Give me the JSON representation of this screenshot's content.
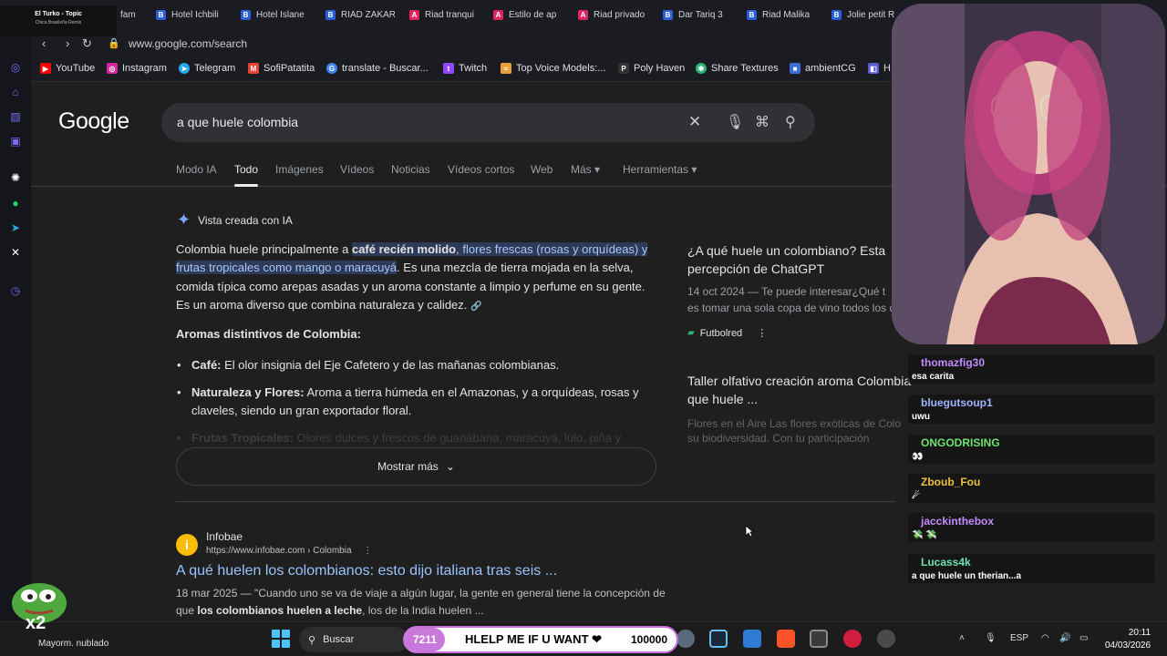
{
  "music": {
    "title": "El Turko - Topic",
    "subtitle": "Chica Brasileña Remix"
  },
  "tabs": [
    {
      "label": "fam",
      "icon": "blank"
    },
    {
      "label": "Hotel Ichbili",
      "icon": "booking"
    },
    {
      "label": "Hotel Islane",
      "icon": "booking"
    },
    {
      "label": "RIAD ZAKAR",
      "icon": "booking"
    },
    {
      "label": "Riad tranqui",
      "icon": "airbnb"
    },
    {
      "label": "Estilo de ap",
      "icon": "airbnb"
    },
    {
      "label": "Riad privado",
      "icon": "airbnb"
    },
    {
      "label": "Dar Tariq 3",
      "icon": "booking"
    },
    {
      "label": "Riad Malika",
      "icon": "booking"
    },
    {
      "label": "Jolie petit R",
      "icon": "booking"
    }
  ],
  "address": {
    "url": "www.google.com/search"
  },
  "bookmarks": [
    {
      "label": "YouTube",
      "icon": "youtube-icon",
      "color": "#ff0000"
    },
    {
      "label": "Instagram",
      "icon": "instagram-icon",
      "color": "#d6249f"
    },
    {
      "label": "Telegram",
      "icon": "telegram-icon",
      "color": "#29a9eb"
    },
    {
      "label": "SofiPatatita",
      "icon": "gmail-icon",
      "color": "#ea4335"
    },
    {
      "label": "translate - Buscar...",
      "icon": "google-icon",
      "color": "#4285f4"
    },
    {
      "label": "Twitch",
      "icon": "twitch-icon",
      "color": "#9146ff"
    },
    {
      "label": "Top Voice Models:...",
      "icon": "voice-icon",
      "color": "#e9a23b"
    },
    {
      "label": "Poly Haven",
      "icon": "polyhaven-icon",
      "color": "#dddddd"
    },
    {
      "label": "Share Textures",
      "icon": "sharetextures-icon",
      "color": "#2bb673"
    },
    {
      "label": "ambientCG",
      "icon": "ambientcg-icon",
      "color": "#3a6fd8"
    },
    {
      "label": "H",
      "icon": "h-icon",
      "color": "#5b5bd6"
    }
  ],
  "google": {
    "logo": "Google",
    "query": "a que huele colombia",
    "search_tabs": [
      "Modo IA",
      "Todo",
      "Imágenes",
      "Vídeos",
      "Noticias",
      "Vídeos cortos",
      "Web",
      "Más ▾",
      "Herramientas ▾"
    ],
    "active_tab": "Todo",
    "ai_overview": {
      "header": "Vista creada con IA",
      "para_1": "Colombia huele principalmente a",
      "hl_bold": "café recién molido",
      "hl_rest": ", flores frescas (rosas y orquídeas) y frutas tropicales como mango o maracuyá",
      "para_2": ". Es una mezcla de tierra mojada en la selva, comida típica como arepas asadas y un aroma constante a limpio y perfume en su gente. Es un aroma diverso que combina naturaleza y calidez.",
      "aromas_heading": "Aromas distintivos de Colombia:",
      "bullets": [
        {
          "bold": "Café:",
          "text": " El olor insignia del Eje Cafetero y de las mañanas colombianas."
        },
        {
          "bold": "Naturaleza y Flores:",
          "text": " Aroma a tierra húmeda en el Amazonas, y a orquídeas, rosas y claveles, siendo un gran exportador floral."
        },
        {
          "bold": "Frutas Tropicales:",
          "text": " Olores dulces y frescos de guanábana, maracuyá, lulo, piña y"
        }
      ],
      "show_more": "Mostrar más"
    },
    "cards": [
      {
        "title_1": "¿A qué huele un colombiano? Esta",
        "title_2": "percepción de ChatGPT",
        "meta_1": "14 oct 2024 — Te puede interesar¿Qué t",
        "meta_2": "es tomar una sola copa de vino todos los d",
        "source": "Futbolred"
      },
      {
        "title_1": "Taller olfativo creación aroma Colombia",
        "title_2": "que huele ...",
        "meta_1": "Flores en el Aire Las flores exóticas de Colo",
        "meta_2": "su biodiversidad. Con tu participación"
      }
    ],
    "result": {
      "site": "Infobae",
      "url": "https://www.infobae.com › Colombia",
      "title": "A qué huelen los colombianos: esto dijo italiana tras seis ...",
      "date": "18 mar 2025",
      "snippet_1": " — \"Cuando uno se va de viaje a algún lugar, la gente en general tiene la concepción de que ",
      "snippet_bold": "los colombianos huelen a leche",
      "snippet_2": ", los de la India huelen ..."
    }
  },
  "chat": [
    {
      "user": "thomazfig30",
      "color": "#c38bff",
      "text": "esa carita"
    },
    {
      "user": "bluegutsoup1",
      "color": "#9fb5ff",
      "text": "uwu"
    },
    {
      "user": "ONGODRISING",
      "color": "#6ee36e",
      "text": "👀"
    },
    {
      "user": "Zboub_Fou",
      "color": "#f0c040",
      "text": "☄"
    },
    {
      "user": "jacckinthebox",
      "color": "#c38bff",
      "text": "💸 💸"
    },
    {
      "user": "Lucass4k",
      "color": "#6ee3b0",
      "text": "a que huele un therian...a"
    }
  ],
  "taskbar": {
    "weather": "Mayorm. nublado",
    "search": "Buscar",
    "goal_left": "7211",
    "goal_text": "HLELP ME IF U WANT ❤",
    "goal_right": "100000",
    "lang": "ESP",
    "time": "20:11",
    "date": "04/03/2026"
  }
}
